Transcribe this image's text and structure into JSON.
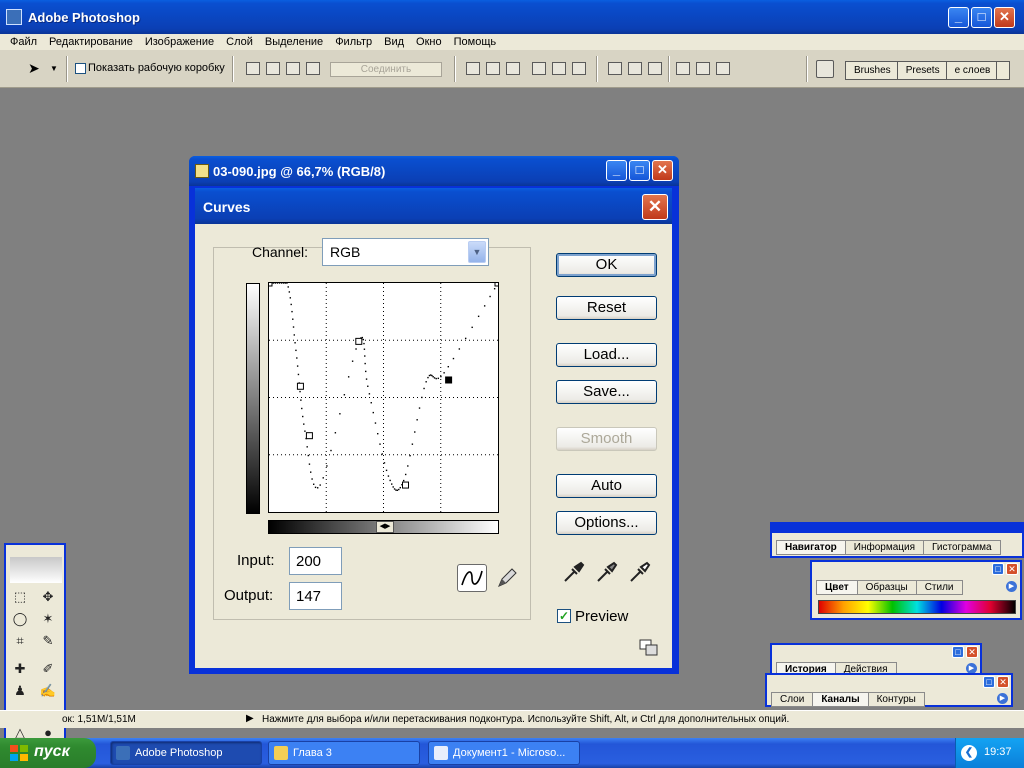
{
  "app": {
    "title": "Adobe Photoshop",
    "window_buttons": {
      "minimize": "_",
      "maximize": "□",
      "close": "✕"
    }
  },
  "menu": [
    "Файл",
    "Редактирование",
    "Изображение",
    "Слой",
    "Выделение",
    "Фильтр",
    "Вид",
    "Окно",
    "Помощь"
  ],
  "toolbar": {
    "show_bounding_box": "Показать рабочую коробку",
    "join_button": "Соединить",
    "palette_well_tabs": [
      "Brushes",
      "Presets",
      "е слоев"
    ]
  },
  "document": {
    "title": "03-090.jpg @ 66,7% (RGB/8)"
  },
  "curves": {
    "title": "Curves",
    "channel_label": "Channel:",
    "channel_value": "RGB",
    "input_label": "Input:",
    "input_value": "200",
    "output_label": "Output:",
    "output_value": "147",
    "buttons": {
      "ok": "OK",
      "reset": "Reset",
      "load": "Load...",
      "save": "Save...",
      "smooth": "Smooth",
      "auto": "Auto",
      "options": "Options..."
    },
    "preview_label": "Preview",
    "preview_checked": true,
    "curve_points_in_out": [
      [
        0,
        255
      ],
      [
        20,
        255
      ],
      [
        30,
        180
      ],
      [
        40,
        90
      ],
      [
        57,
        30
      ],
      [
        100,
        190
      ],
      [
        110,
        140
      ],
      [
        133,
        40
      ],
      [
        150,
        35
      ],
      [
        175,
        145
      ],
      [
        195,
        155
      ],
      [
        255,
        255
      ]
    ],
    "control_points_in_out": [
      [
        0,
        255
      ],
      [
        35,
        140
      ],
      [
        45,
        85
      ],
      [
        100,
        190
      ],
      [
        152,
        30
      ],
      [
        200,
        147
      ],
      [
        255,
        255
      ]
    ]
  },
  "palettes": {
    "navigator_group": {
      "tabs": [
        "Навигатор",
        "Информация",
        "Гистограмма"
      ],
      "active": "Навигатор"
    },
    "color_group": {
      "tabs": [
        "Цвет",
        "Образцы",
        "Стили"
      ],
      "active": "Цвет"
    },
    "history_group": {
      "tabs": [
        "История",
        "Действия"
      ],
      "active": "История"
    },
    "layers_group": {
      "tabs": [
        "Слои",
        "Каналы",
        "Контуры"
      ],
      "active": "Каналы"
    }
  },
  "status": {
    "doc_size": "ок: 1,51M/1,51M",
    "hint": "Нажмите для выбора и/или перетаскивания подконтура.  Используйте Shift, Alt, и Ctrl для дополнительных опций."
  },
  "taskbar": {
    "start_label": "пуск",
    "tasks": [
      {
        "label": "Adobe Photoshop",
        "active": true
      },
      {
        "label": "Глава 3",
        "active": false
      },
      {
        "label": "Документ1 - Microso...",
        "active": false
      }
    ],
    "clock": "19:37"
  },
  "colors": {
    "xp_blue": "#0831d9",
    "dialog_bg": "#ece9d8",
    "desktop": "#808080",
    "start_green": "#2f8a2f"
  }
}
